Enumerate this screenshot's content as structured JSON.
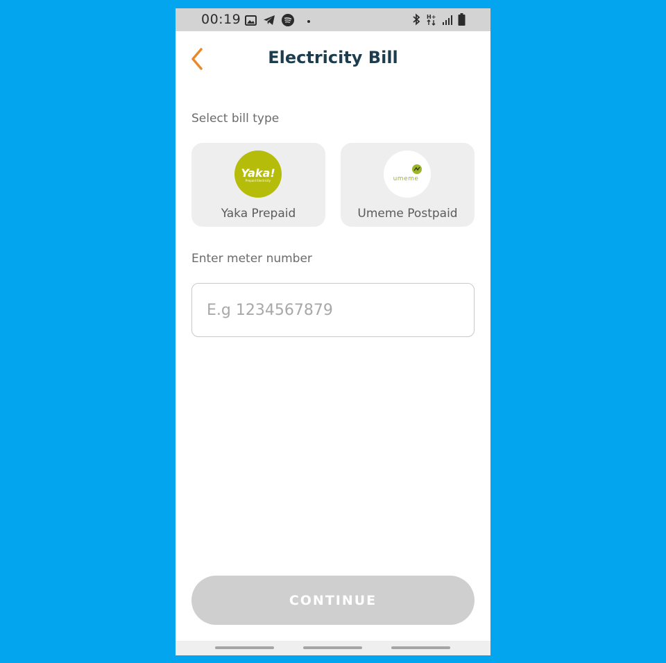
{
  "status_bar": {
    "time": "00:19",
    "left_icons": [
      "image-icon",
      "telegram-icon",
      "spotify-icon",
      "dot-icon"
    ],
    "right_icons": [
      "bluetooth-icon",
      "network-hplus-icon",
      "signal-icon",
      "battery-icon"
    ],
    "network_label": "H+"
  },
  "header": {
    "title": "Electricity Bill",
    "back_icon": "chevron-left-icon"
  },
  "bill_type": {
    "label": "Select bill type",
    "options": [
      {
        "name": "Yaka Prepaid",
        "logo_text": "Yaka!",
        "logo_subtext": "Prepaid Electricity",
        "logo_color": "#b5bd0a"
      },
      {
        "name": "Umeme Postpaid",
        "logo_text": "umeme",
        "logo_color": "#ffffff",
        "brand_color": "#9db52b"
      }
    ]
  },
  "meter": {
    "label": "Enter meter number",
    "placeholder": "E.g 1234567879",
    "value": ""
  },
  "actions": {
    "continue_label": "CONTINUE"
  },
  "colors": {
    "background": "#03a6ee",
    "accent": "#e9892a",
    "title": "#1d3c4d",
    "button_disabled": "#cfcfcf"
  }
}
